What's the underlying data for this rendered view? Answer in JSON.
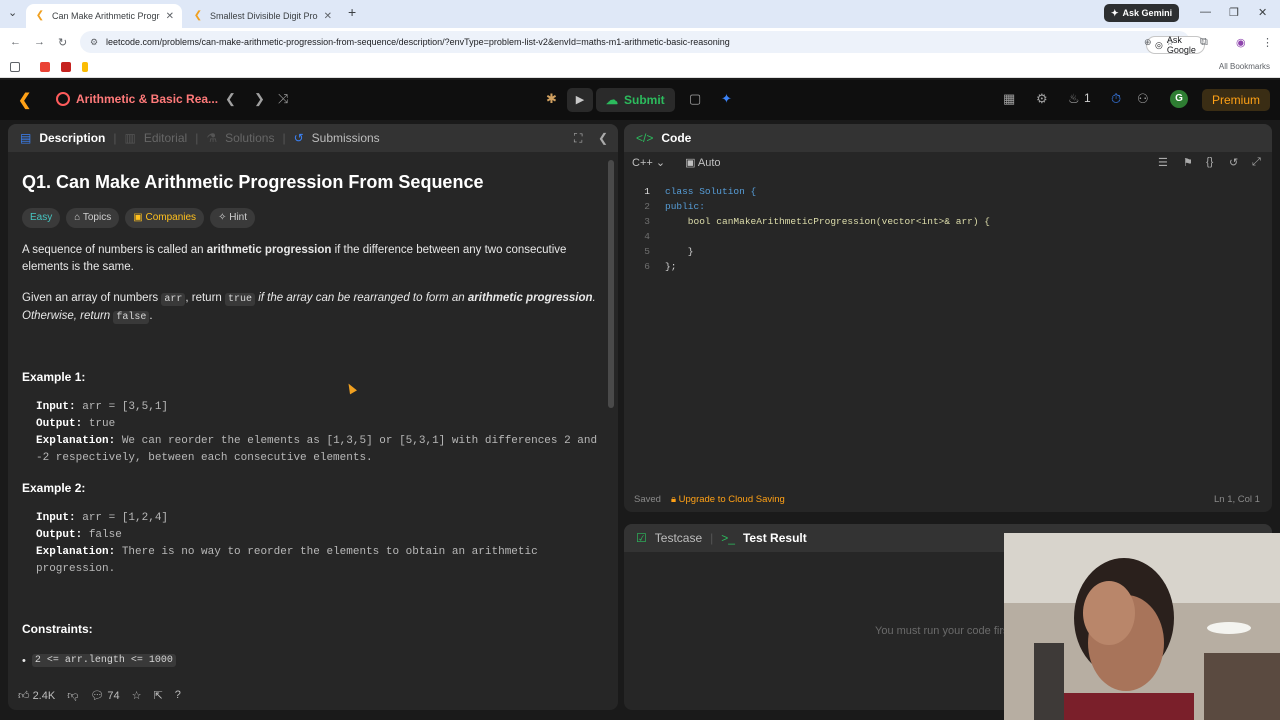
{
  "browser": {
    "tabs": [
      {
        "title": "Can Make Arithmetic Progressio",
        "active": true
      },
      {
        "title": "Smallest Divisible Digit Produc",
        "active": false
      }
    ],
    "new_tab": "+",
    "gemini_label": "Ask Gemini",
    "url": "leetcode.com/problems/can-make-arithmetic-progression-from-sequence/description/?envType=problem-list-v2&envId=maths-m1-arithmetic-basic-reasoning",
    "ask_google": "Ask Google",
    "all_bookmarks": "All Bookmarks"
  },
  "lc_nav": {
    "problem_list": "Arithmetic & Basic Rea...",
    "submit_label": "Submit",
    "streak": "1",
    "avatar_letter": "G",
    "premium_label": "Premium"
  },
  "description_panel": {
    "tabs": [
      "Description",
      "Editorial",
      "Solutions",
      "Submissions"
    ],
    "title": "Q1. Can Make Arithmetic Progression From Sequence",
    "tags": [
      "Easy",
      "Topics",
      "Companies",
      "Hint"
    ],
    "para1_a": "A sequence of numbers is called an ",
    "para1_b": "arithmetic progression",
    "para1_c": " if the difference between any two consecutive elements is the same.",
    "para2_a": "Given an array of numbers ",
    "para2_arr": "arr",
    "para2_b": ", return ",
    "para2_true": "true",
    "para2_c": " if the array can be rearranged to form an ",
    "para2_d": "arithmetic progression",
    "para2_e": ". Otherwise, return ",
    "para2_false": "false",
    "para2_f": ".",
    "example1_head": "Example 1:",
    "example1": {
      "input_label": "Input:",
      "input": "arr = [3,5,1]",
      "output_label": "Output:",
      "output": "true",
      "explanation_label": "Explanation:",
      "explanation": "We can reorder the elements as [1,3,5] or [5,3,1] with differences 2 and -2 respectively, between each consecutive elements."
    },
    "example2_head": "Example 2:",
    "example2": {
      "input_label": "Input:",
      "input": "arr = [1,2,4]",
      "output_label": "Output:",
      "output": "false",
      "explanation_label": "Explanation:",
      "explanation": "There is no way to reorder the elements to obtain an arithmetic progression."
    },
    "constraints_head": "Constraints:",
    "constraint1": "2 <= arr.length <= 1000",
    "likes": "2.4K",
    "comments": "74"
  },
  "code_panel": {
    "header": "Code",
    "language": "C++",
    "auto_label": "Auto",
    "lines": [
      {
        "n": "1",
        "code": "class Solution {"
      },
      {
        "n": "2",
        "code": "public:"
      },
      {
        "n": "3",
        "code": "    bool canMakeArithmeticProgression(vector<int>& arr) {"
      },
      {
        "n": "4",
        "code": ""
      },
      {
        "n": "5",
        "code": "    }"
      },
      {
        "n": "6",
        "code": "};"
      }
    ],
    "saved": "Saved",
    "upgrade": "Upgrade to Cloud Saving",
    "cursor_pos": "Ln 1, Col 1"
  },
  "test_panel": {
    "tabs": [
      "Testcase",
      "Test Result"
    ],
    "hint": "You must run your code first"
  },
  "colors": {
    "accent": "#ffa116",
    "submit_green": "#2cbb5d",
    "easy": "#46c6c2"
  }
}
